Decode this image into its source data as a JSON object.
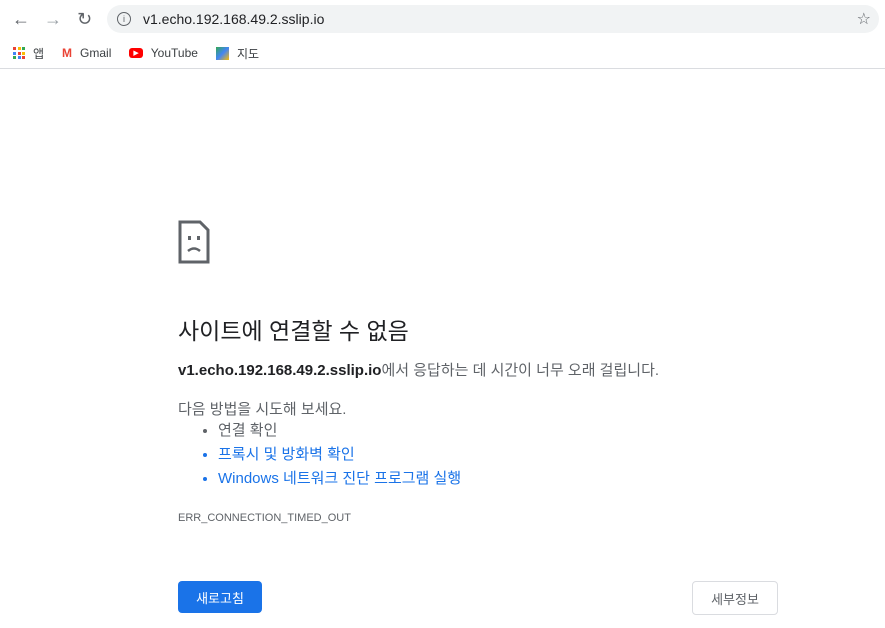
{
  "browser": {
    "url": "v1.echo.192.168.49.2.sslip.io",
    "bookmarks": [
      {
        "label": "앱"
      },
      {
        "label": "Gmail"
      },
      {
        "label": "YouTube"
      },
      {
        "label": "지도"
      }
    ]
  },
  "error": {
    "title": "사이트에 연결할 수 없음",
    "host": "v1.echo.192.168.49.2.sslip.io",
    "message": "에서 응답하는 데 시간이 너무 오래 걸립니다.",
    "try_label": "다음 방법을 시도해 보세요.",
    "suggestions": [
      "연결 확인",
      "프록시 및 방화벽 확인",
      "Windows 네트워크 진단 프로그램 실행"
    ],
    "code": "ERR_CONNECTION_TIMED_OUT",
    "reload_label": "새로고침",
    "details_label": "세부정보"
  }
}
